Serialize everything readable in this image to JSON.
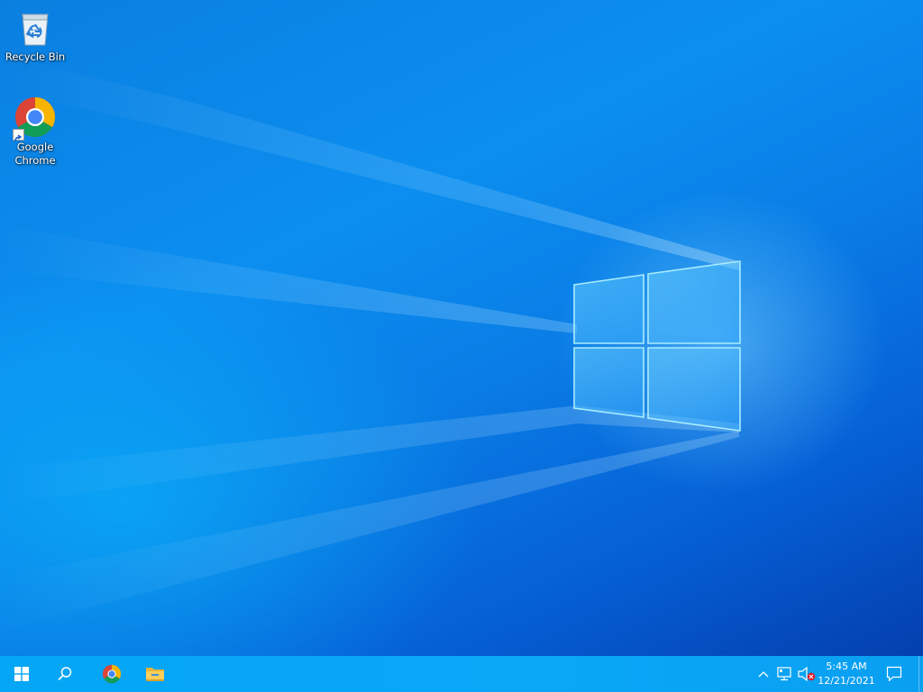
{
  "desktop": {
    "icons": [
      {
        "label": "Recycle Bin",
        "icon": "recycle-bin-icon"
      },
      {
        "label": "Google\nChrome",
        "icon": "chrome-icon",
        "shortcut": true
      }
    ]
  },
  "taskbar": {
    "start_icon": "windows-start-icon",
    "search_icon": "search-icon",
    "pinned": [
      {
        "app": "Google Chrome",
        "icon": "chrome-icon"
      },
      {
        "app": "File Explorer",
        "icon": "folder-icon"
      }
    ],
    "tray": {
      "chevron_icon": "chevron-up-icon",
      "network_icon": "network-icon",
      "volume_icon": "volume-muted-icon",
      "time": "5:45 AM",
      "date": "12/21/2021",
      "notification_icon": "notification-icon"
    }
  },
  "colors": {
    "taskbar": "#0aa7f7",
    "wallpaper_primary": "#0a7fe0",
    "wallpaper_dark": "#043fae",
    "logo_glow": "#7fe0ff"
  }
}
